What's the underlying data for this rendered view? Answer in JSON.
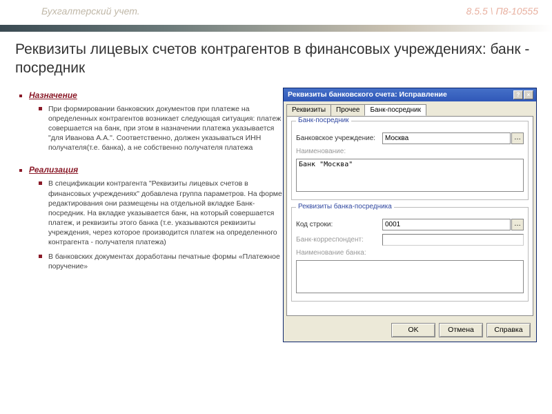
{
  "header": {
    "title": "Бухгалтерский учет.",
    "version": "8.5.5 \\ П8-10555"
  },
  "page_title": "Реквизиты лицевых счетов контрагентов в финансовых учреждениях: банк - посредник",
  "sections": {
    "s1": {
      "heading": "Назначение",
      "items": [
        "При формировании банковских документов при платеже на определенных контрагентов возникает следующая ситуация: платеж совершается на банк, при этом в назначении платежа указывается \"для Иванова А.А.\". Соответственно, должен указываться ИНН получателя(т.е. банка), а не собственно получателя платежа"
      ]
    },
    "s2": {
      "heading": "Реализация",
      "items": [
        "В спецификации контрагента \"Реквизиты лицевых счетов в финансовых учреждениях\" добавлена группа параметров. На форме редактирования они размещены на отдельной вкладке Банк-посредник. На вкладке указывается банк, на который совершается платеж, и реквизиты этого банка (т.е. указываются реквизиты учреждения, через которое производится платеж на определенного контрагента - получателя платежа)",
        "В банковских документах доработаны печатные формы «Платежное поручение»"
      ]
    }
  },
  "dialog": {
    "title": "Реквизиты банковского счета: Исправление",
    "tabs": [
      "Реквизиты",
      "Прочее",
      "Банк-посредник"
    ],
    "group1": {
      "title": "Банк-посредник",
      "bank_inst_label": "Банковское учреждение:",
      "bank_inst_value": "Москва",
      "name_label": "Наименование:",
      "name_value": "Банк \"Москва\""
    },
    "group2": {
      "title": "Реквизиты банка-посредника",
      "code_label": "Код строки:",
      "code_value": "0001",
      "corr_label": "Банк-корреспондент:",
      "name2_label": "Наименование банка:"
    },
    "buttons": {
      "ok": "OK",
      "cancel": "Отмена",
      "help": "Справка"
    }
  }
}
